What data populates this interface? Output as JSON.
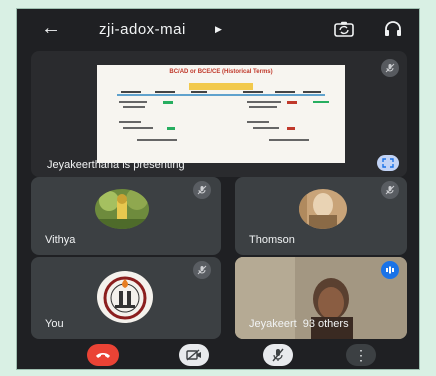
{
  "app": {
    "meeting_code": "zji-adox-mai"
  },
  "presentation": {
    "label": "Jeyakeerthana is presenting",
    "slide_title": "BC/AD or BCE/CE (Historical Terms)"
  },
  "participants": [
    {
      "name": "Vithya",
      "muted": true
    },
    {
      "name": "Thomson",
      "muted": true
    },
    {
      "name": "You",
      "muted": true
    },
    {
      "name": "Jeyakeert",
      "speaking": true
    }
  ],
  "overflow": {
    "label": "93 others"
  },
  "colors": {
    "background": "#1f2023",
    "tile": "#3c4043",
    "end_call": "#ea4335",
    "control_light": "#e8eaed",
    "accent_blue": "#1a73e8"
  },
  "icons": {
    "back": "arrow-left-icon",
    "switch_camera": "switch-camera-icon",
    "audio": "headphones-icon",
    "muted": "mic-off-icon",
    "fullscreen": "fullscreen-icon",
    "end_call": "phone-hangup-icon",
    "camera_off": "camera-off-icon",
    "mic_off": "mic-off-icon",
    "more": "more-vertical-icon"
  }
}
